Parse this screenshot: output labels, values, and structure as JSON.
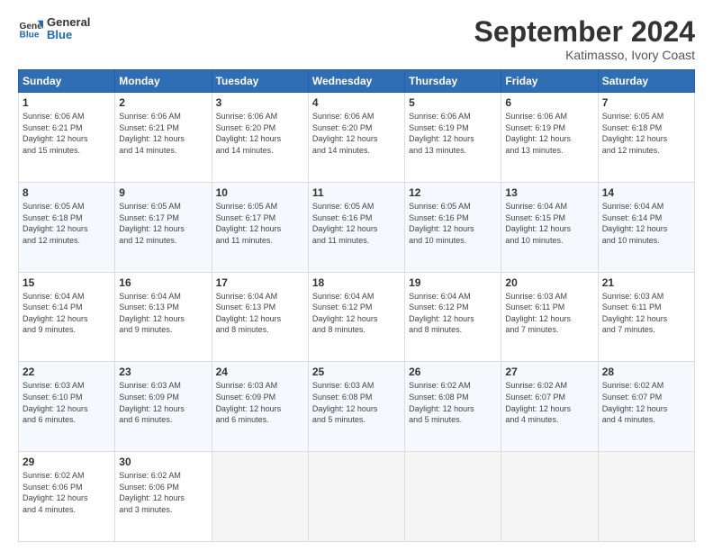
{
  "header": {
    "logo_line1": "General",
    "logo_line2": "Blue",
    "month": "September 2024",
    "location": "Katimasso, Ivory Coast"
  },
  "weekdays": [
    "Sunday",
    "Monday",
    "Tuesday",
    "Wednesday",
    "Thursday",
    "Friday",
    "Saturday"
  ],
  "weeks": [
    [
      {
        "day": "1",
        "info": "Sunrise: 6:06 AM\nSunset: 6:21 PM\nDaylight: 12 hours\nand 15 minutes."
      },
      {
        "day": "2",
        "info": "Sunrise: 6:06 AM\nSunset: 6:21 PM\nDaylight: 12 hours\nand 14 minutes."
      },
      {
        "day": "3",
        "info": "Sunrise: 6:06 AM\nSunset: 6:20 PM\nDaylight: 12 hours\nand 14 minutes."
      },
      {
        "day": "4",
        "info": "Sunrise: 6:06 AM\nSunset: 6:20 PM\nDaylight: 12 hours\nand 14 minutes."
      },
      {
        "day": "5",
        "info": "Sunrise: 6:06 AM\nSunset: 6:19 PM\nDaylight: 12 hours\nand 13 minutes."
      },
      {
        "day": "6",
        "info": "Sunrise: 6:06 AM\nSunset: 6:19 PM\nDaylight: 12 hours\nand 13 minutes."
      },
      {
        "day": "7",
        "info": "Sunrise: 6:05 AM\nSunset: 6:18 PM\nDaylight: 12 hours\nand 12 minutes."
      }
    ],
    [
      {
        "day": "8",
        "info": "Sunrise: 6:05 AM\nSunset: 6:18 PM\nDaylight: 12 hours\nand 12 minutes."
      },
      {
        "day": "9",
        "info": "Sunrise: 6:05 AM\nSunset: 6:17 PM\nDaylight: 12 hours\nand 12 minutes."
      },
      {
        "day": "10",
        "info": "Sunrise: 6:05 AM\nSunset: 6:17 PM\nDaylight: 12 hours\nand 11 minutes."
      },
      {
        "day": "11",
        "info": "Sunrise: 6:05 AM\nSunset: 6:16 PM\nDaylight: 12 hours\nand 11 minutes."
      },
      {
        "day": "12",
        "info": "Sunrise: 6:05 AM\nSunset: 6:16 PM\nDaylight: 12 hours\nand 10 minutes."
      },
      {
        "day": "13",
        "info": "Sunrise: 6:04 AM\nSunset: 6:15 PM\nDaylight: 12 hours\nand 10 minutes."
      },
      {
        "day": "14",
        "info": "Sunrise: 6:04 AM\nSunset: 6:14 PM\nDaylight: 12 hours\nand 10 minutes."
      }
    ],
    [
      {
        "day": "15",
        "info": "Sunrise: 6:04 AM\nSunset: 6:14 PM\nDaylight: 12 hours\nand 9 minutes."
      },
      {
        "day": "16",
        "info": "Sunrise: 6:04 AM\nSunset: 6:13 PM\nDaylight: 12 hours\nand 9 minutes."
      },
      {
        "day": "17",
        "info": "Sunrise: 6:04 AM\nSunset: 6:13 PM\nDaylight: 12 hours\nand 8 minutes."
      },
      {
        "day": "18",
        "info": "Sunrise: 6:04 AM\nSunset: 6:12 PM\nDaylight: 12 hours\nand 8 minutes."
      },
      {
        "day": "19",
        "info": "Sunrise: 6:04 AM\nSunset: 6:12 PM\nDaylight: 12 hours\nand 8 minutes."
      },
      {
        "day": "20",
        "info": "Sunrise: 6:03 AM\nSunset: 6:11 PM\nDaylight: 12 hours\nand 7 minutes."
      },
      {
        "day": "21",
        "info": "Sunrise: 6:03 AM\nSunset: 6:11 PM\nDaylight: 12 hours\nand 7 minutes."
      }
    ],
    [
      {
        "day": "22",
        "info": "Sunrise: 6:03 AM\nSunset: 6:10 PM\nDaylight: 12 hours\nand 6 minutes."
      },
      {
        "day": "23",
        "info": "Sunrise: 6:03 AM\nSunset: 6:09 PM\nDaylight: 12 hours\nand 6 minutes."
      },
      {
        "day": "24",
        "info": "Sunrise: 6:03 AM\nSunset: 6:09 PM\nDaylight: 12 hours\nand 6 minutes."
      },
      {
        "day": "25",
        "info": "Sunrise: 6:03 AM\nSunset: 6:08 PM\nDaylight: 12 hours\nand 5 minutes."
      },
      {
        "day": "26",
        "info": "Sunrise: 6:02 AM\nSunset: 6:08 PM\nDaylight: 12 hours\nand 5 minutes."
      },
      {
        "day": "27",
        "info": "Sunrise: 6:02 AM\nSunset: 6:07 PM\nDaylight: 12 hours\nand 4 minutes."
      },
      {
        "day": "28",
        "info": "Sunrise: 6:02 AM\nSunset: 6:07 PM\nDaylight: 12 hours\nand 4 minutes."
      }
    ],
    [
      {
        "day": "29",
        "info": "Sunrise: 6:02 AM\nSunset: 6:06 PM\nDaylight: 12 hours\nand 4 minutes."
      },
      {
        "day": "30",
        "info": "Sunrise: 6:02 AM\nSunset: 6:06 PM\nDaylight: 12 hours\nand 3 minutes."
      },
      {
        "day": "",
        "info": ""
      },
      {
        "day": "",
        "info": ""
      },
      {
        "day": "",
        "info": ""
      },
      {
        "day": "",
        "info": ""
      },
      {
        "day": "",
        "info": ""
      }
    ]
  ]
}
